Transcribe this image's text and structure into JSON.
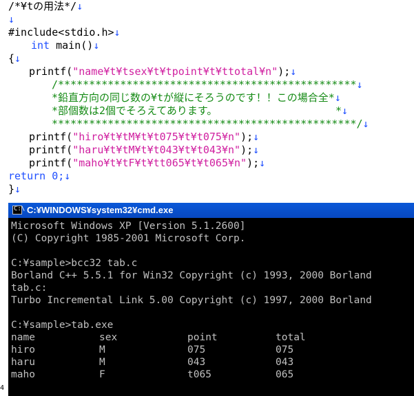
{
  "editor": {
    "line1": "/*¥tの用法*/",
    "line3": "#include<stdio.h>",
    "line4_kw": "int",
    "line4_rest": " main()",
    "line5": "{",
    "line6_fn": "printf(",
    "line6_str": "\"name¥t¥tsex¥t¥tpoint¥t¥ttotal¥n\"",
    "line6_end": ");",
    "line7": "/************************************************",
    "line8": "*鉛直方向の同じ数の¥tが縦にそろうのです！！この場合全*",
    "line9": "*部個数は2個でそろえてあります。                   *",
    "line10": "*************************************************/",
    "line11_str": "\"hiro¥t¥tM¥t¥t075¥t¥t075¥n\"",
    "line12_str": "\"haru¥t¥tM¥t¥t043¥t¥t043¥n\"",
    "line13_str": "\"maho¥t¥tF¥t¥tt065¥t¥t065¥n\"",
    "line14": "return 0;",
    "line15": "}",
    "newline_glyph": "↓"
  },
  "cmd": {
    "title": "C:¥WINDOWS¥system32¥cmd.exe",
    "icon_label": "C:\\",
    "lines": [
      "Microsoft Windows XP [Version 5.1.2600]",
      "(C) Copyright 1985-2001 Microsoft Corp.",
      "",
      "C:¥sample>bcc32 tab.c",
      "Borland C++ 5.5.1 for Win32 Copyright (c) 1993, 2000 Borland",
      "tab.c:",
      "Turbo Incremental Link 5.00 Copyright (c) 1997, 2000 Borland",
      "",
      "C:¥sample>tab.exe"
    ],
    "table": [
      [
        "name",
        "sex",
        "point",
        "total"
      ],
      [
        "hiro",
        "M",
        "075",
        "075"
      ],
      [
        "haru",
        "M",
        "043",
        "043"
      ],
      [
        "maho",
        "F",
        "t065",
        "065"
      ]
    ]
  },
  "corner_text": "4"
}
